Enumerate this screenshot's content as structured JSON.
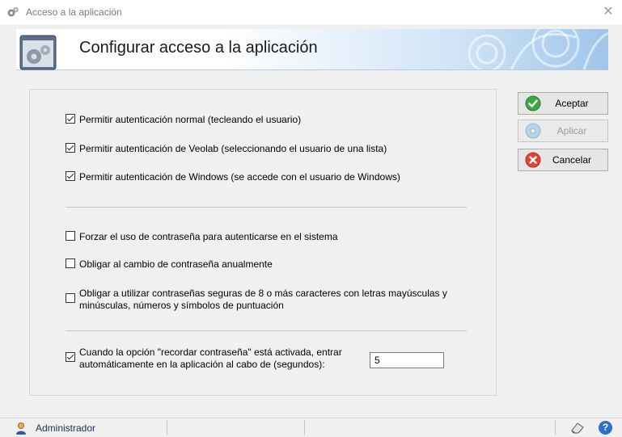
{
  "window": {
    "title": "Acceso a la aplicación",
    "close_symbol": "✕"
  },
  "banner": {
    "heading": "Configurar acceso a la aplicación"
  },
  "options": {
    "auth_normal": {
      "label": "Permitir autenticación normal (tecleando el usuario)",
      "checked": true
    },
    "auth_veolab": {
      "label": "Permitir autenticación de Veolab (seleccionando el usuario de una lista)",
      "checked": true
    },
    "auth_windows": {
      "label": "Permitir autenticación de Windows (se accede con el usuario de Windows)",
      "checked": true
    },
    "force_password": {
      "label": "Forzar el uso de contraseña para autenticarse en el sistema",
      "checked": false
    },
    "annual_change": {
      "label": "Obligar al cambio de contraseña anualmente",
      "checked": false
    },
    "secure_passwords": {
      "label_line1": "Obligar a utilizar contraseñas seguras de 8 o más caracteres con letras mayúsculas y",
      "label_line2": "minúsculas, números y símbolos de puntuación",
      "checked": false
    },
    "remember_password": {
      "label_line1": "Cuando la opción \"recordar contraseña\" está activada, entrar",
      "label_line2": "automáticamente en la aplicación al cabo de (segundos):",
      "checked": true,
      "seconds": "5"
    }
  },
  "buttons": {
    "accept": {
      "label": "Aceptar",
      "icon": "check-icon"
    },
    "apply": {
      "label": "Aplicar",
      "icon": "disc-icon",
      "disabled": true
    },
    "cancel": {
      "label": "Cancelar",
      "icon": "cancel-icon"
    }
  },
  "status": {
    "user": "Administrador",
    "help": "?"
  }
}
